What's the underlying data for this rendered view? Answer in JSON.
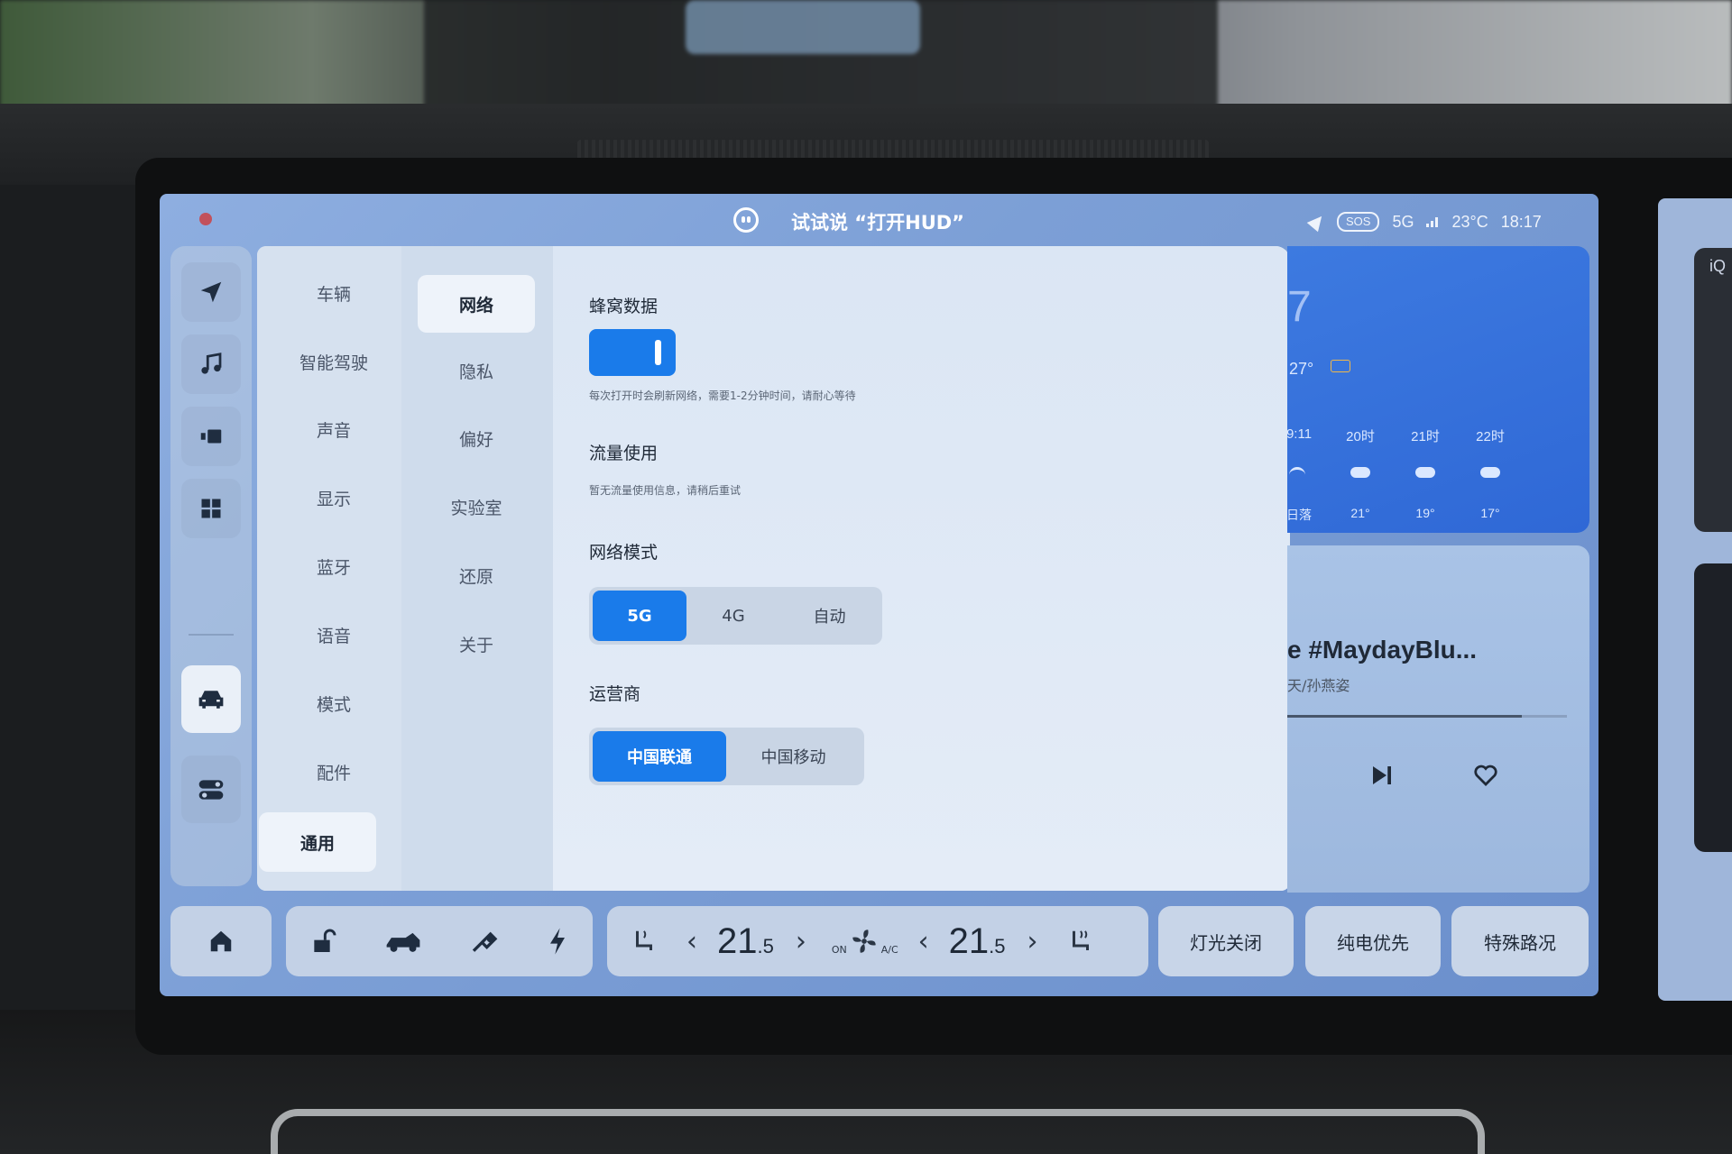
{
  "status_bar": {
    "voice_hint": "试试说 “打开HUD”",
    "sos": "SOS",
    "network": "5G",
    "temperature": "23°C",
    "time": "18:17"
  },
  "dock": {
    "items": [
      "navigation-icon",
      "music-icon",
      "media-icon",
      "apps-icon",
      "car-icon",
      "toggles-icon"
    ]
  },
  "settings": {
    "primary_menu": [
      "车辆",
      "智能驾驶",
      "声音",
      "显示",
      "蓝牙",
      "语音",
      "模式",
      "配件",
      "通用"
    ],
    "primary_selected": "通用",
    "secondary_menu": [
      "网络",
      "隐私",
      "偏好",
      "实验室",
      "还原",
      "关于"
    ],
    "secondary_selected": "网络",
    "cellular": {
      "title": "蜂窝数据",
      "enabled": true,
      "desc": "每次打开时会刷新网络，需要1-2分钟时间，请耐心等待"
    },
    "data_usage": {
      "title": "流量使用",
      "desc": "暂无流量使用信息，请稍后重试"
    },
    "network_mode": {
      "title": "网络模式",
      "options": [
        "5G",
        "4G",
        "自动"
      ],
      "selected": "5G"
    },
    "carrier": {
      "title": "运营商",
      "options": [
        "中国联通",
        "中国移动"
      ],
      "selected": "中国联通"
    }
  },
  "weather": {
    "current_temp": "27°",
    "hours": [
      "9:11",
      "20时",
      "21时",
      "22时"
    ],
    "temps": [
      "日落",
      "21°",
      "19°",
      "17°"
    ]
  },
  "music": {
    "title": "e #MaydayBlu...",
    "artist": "天/孙燕姿",
    "progress": 0.84
  },
  "bottom_bar": {
    "left_temp_main": "21",
    "left_temp_dec": ".5",
    "right_temp_main": "21",
    "right_temp_dec": ".5",
    "fan_on": "ON",
    "ac": "A/C",
    "buttons": [
      "灯光关闭",
      "纯电优先",
      "特殊路况"
    ]
  },
  "right_screen": {
    "label": "iQ"
  }
}
